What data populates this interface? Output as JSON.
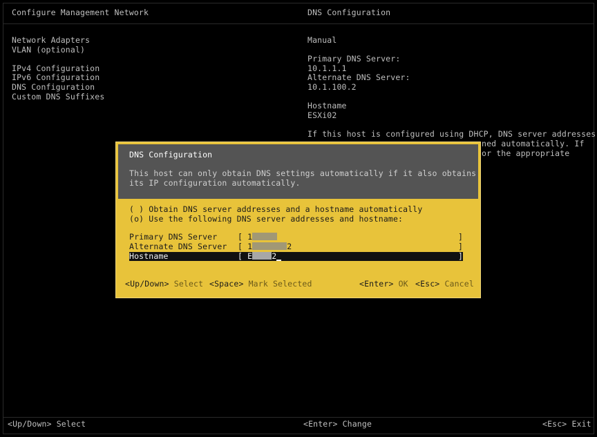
{
  "header": {
    "left_title": "Configure Management Network",
    "right_title": "DNS Configuration"
  },
  "left_menu": {
    "items": [
      "Network Adapters",
      "VLAN (optional)",
      "IPv4 Configuration",
      "IPv6 Configuration",
      "DNS Configuration",
      "Custom DNS Suffixes"
    ]
  },
  "right_pane": {
    "mode": "Manual",
    "primary_label": "Primary DNS Server:",
    "primary_value": "10.1.1.1",
    "alternate_label": "Alternate DNS Server:",
    "alternate_value": "10.1.100.2",
    "hostname_label": "Hostname",
    "hostname_value": "ESXi02",
    "info_line1": "If this host is configured using DHCP, DNS server addresses",
    "info_line2": "ned automatically. If",
    "info_line3": "or the appropriate"
  },
  "dialog": {
    "title": "DNS Configuration",
    "description_line1": "This host can only obtain DNS settings automatically if it also obtains",
    "description_line2": "its IP configuration automatically.",
    "option_auto": "( ) Obtain DNS server addresses and a hostname automatically",
    "option_manual": "(o) Use the following DNS server addresses and hostname:",
    "primary_label": "Primary DNS Server",
    "primary_prefix": "[ 1",
    "alternate_label": "Alternate DNS Server",
    "alternate_prefix": "[ 1",
    "alternate_suffix": "2",
    "hostname_label": "Hostname",
    "hostname_prefix": "[ E",
    "hostname_suffix": "2",
    "bracket_close": "]",
    "hint_updown_key": "<Up/Down>",
    "hint_updown_desc": "Select",
    "hint_space_key": "<Space>",
    "hint_space_desc": "Mark Selected",
    "hint_enter_key": "<Enter>",
    "hint_enter_desc": "OK",
    "hint_esc_key": "<Esc>",
    "hint_esc_desc": "Cancel"
  },
  "footer": {
    "left": "<Up/Down> Select",
    "center": "<Enter> Change",
    "right": "<Esc> Exit"
  }
}
